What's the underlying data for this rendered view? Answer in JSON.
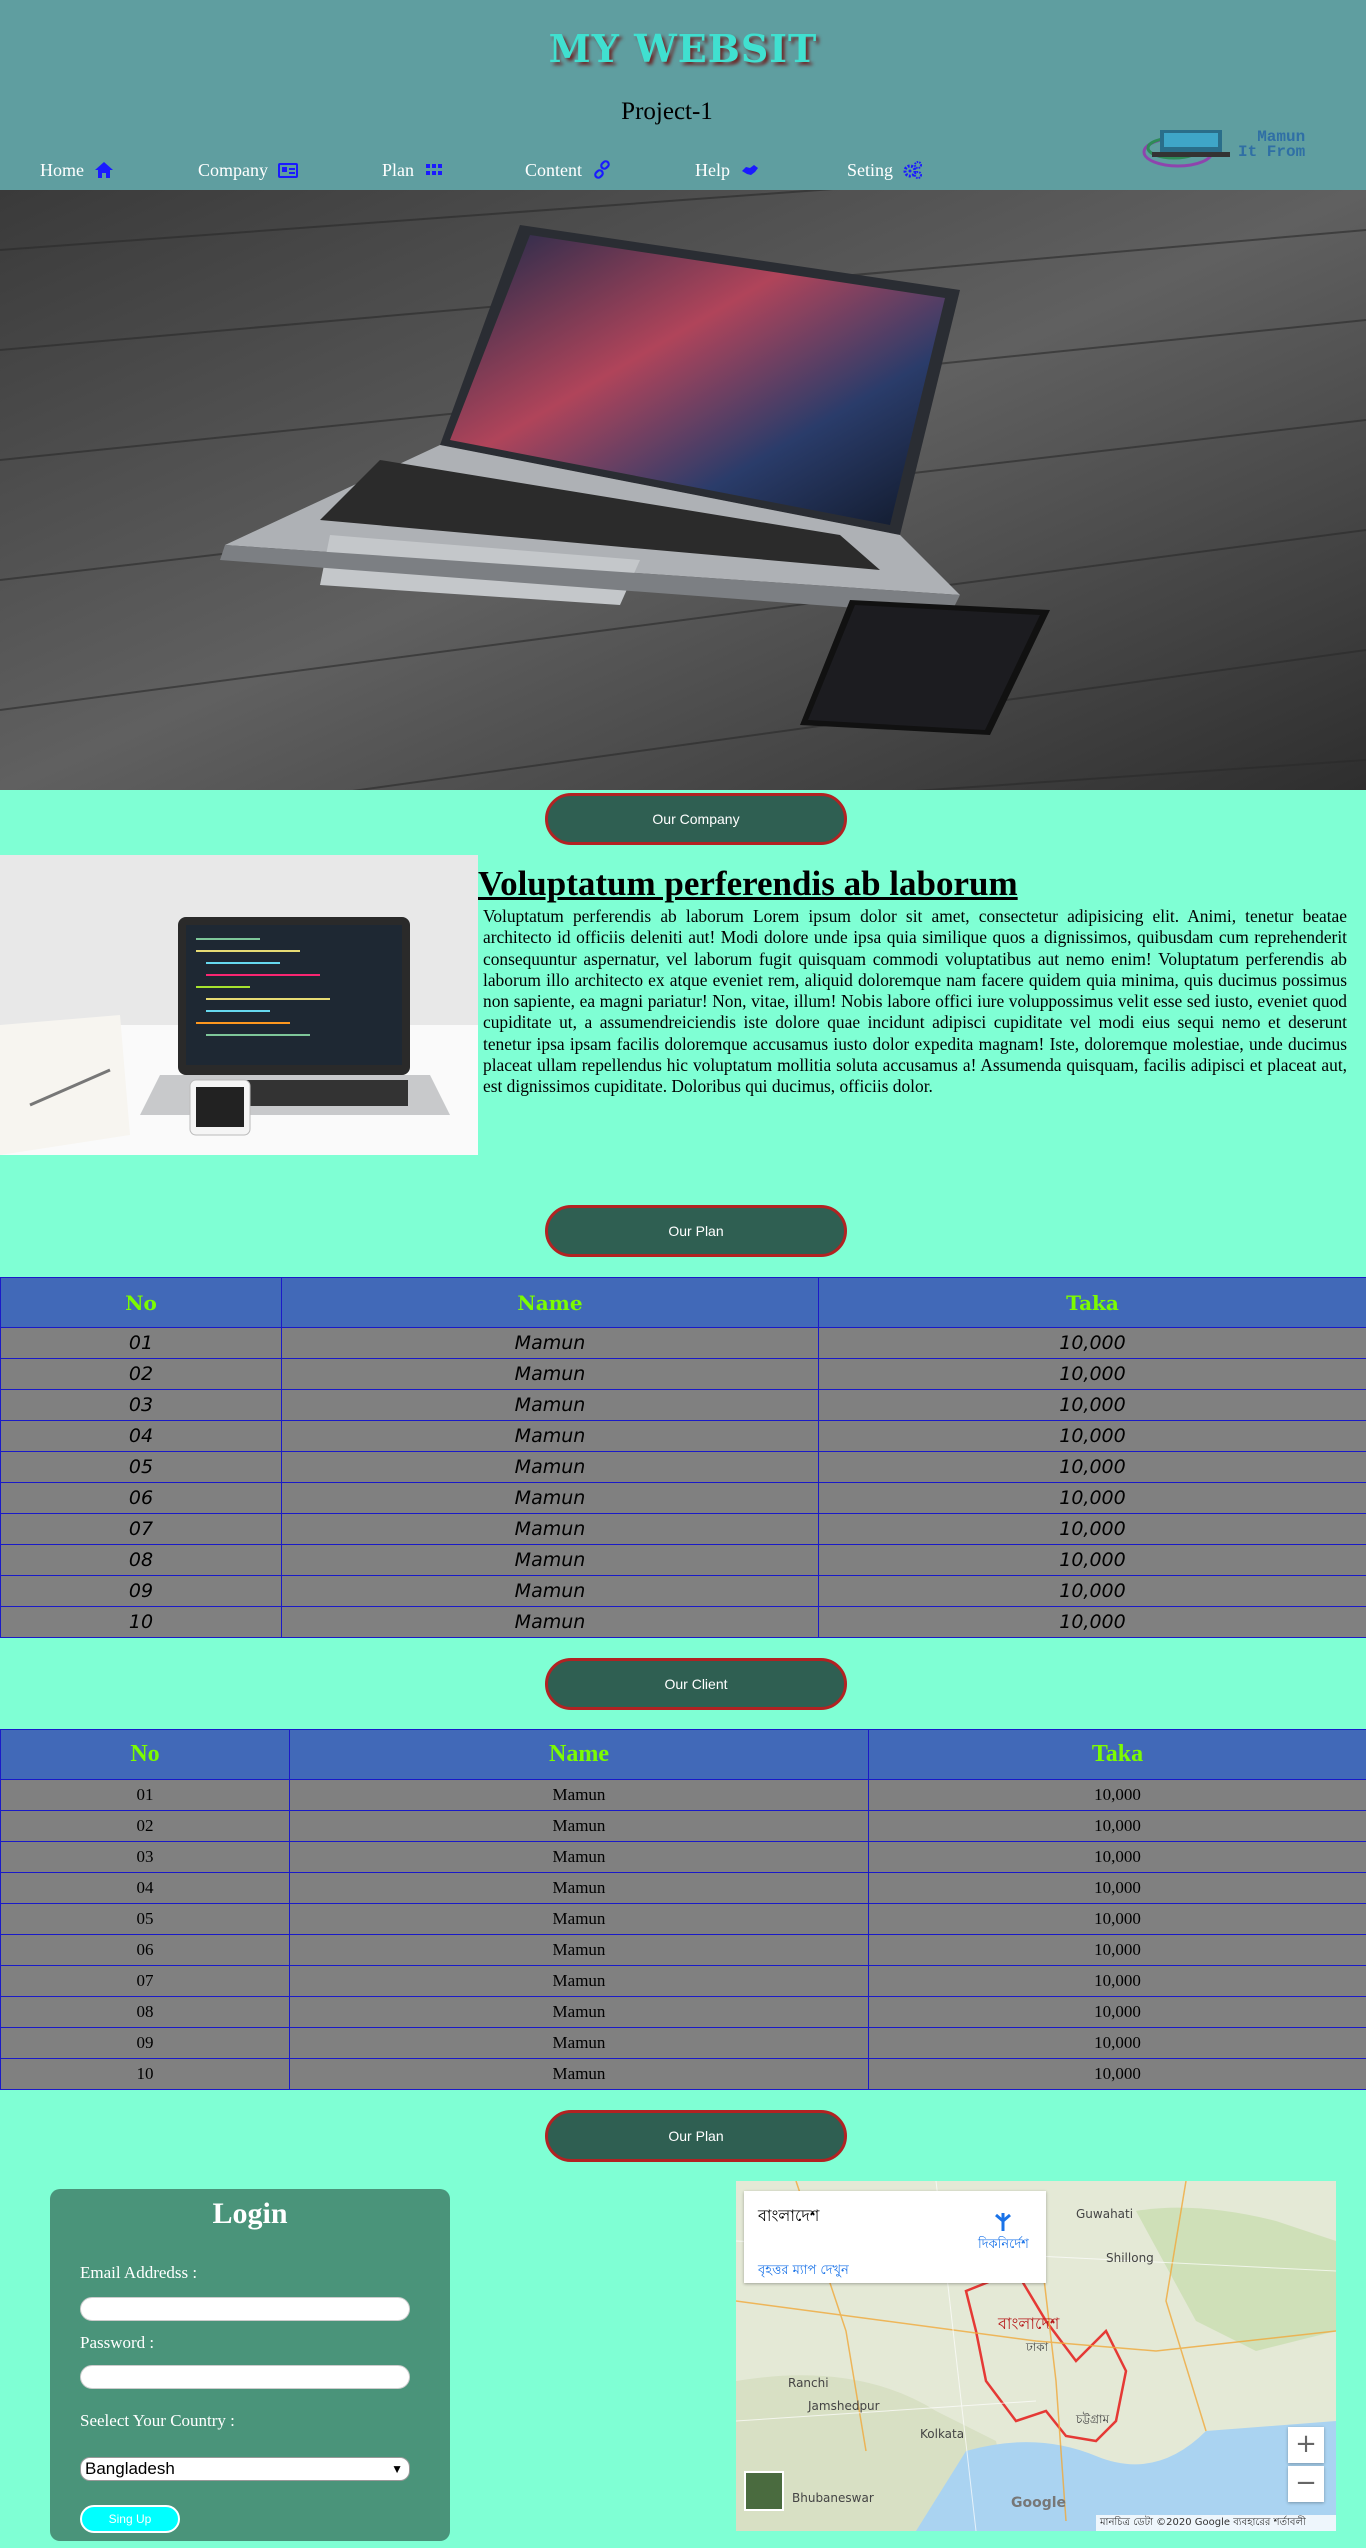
{
  "header": {
    "site_title": "MY WEBSIT",
    "project": "Project-1",
    "nav": [
      {
        "label": "Home",
        "icon": "home-icon"
      },
      {
        "label": "Company",
        "icon": "id-card-icon"
      },
      {
        "label": "Plan",
        "icon": "grid-icon"
      },
      {
        "label": "Content",
        "icon": "link-icon"
      },
      {
        "label": "Help",
        "icon": "handshake-icon"
      },
      {
        "label": "Seting",
        "icon": "gears-icon"
      }
    ],
    "logo_text_1": "Mamun",
    "logo_text_2": "It From"
  },
  "buttons": {
    "company": "Our Company",
    "plan": "Our Plan",
    "client": "Our Client",
    "plan2": "Our Plan"
  },
  "about": {
    "heading": "Voluptatum perferendis ab laborum",
    "text": "Voluptatum perferendis ab laborum Lorem ipsum dolor sit amet, consectetur adipisicing elit. Animi, tenetur beatae architecto id officiis deleniti aut! Modi dolore unde ipsa quia similique quos a dignissimos, quibusdam cum reprehenderit consequuntur aspernatur, vel laborum fugit quisquam commodi voluptatibus aut nemo enim! Voluptatum perferendis ab laborum illo architecto ex atque eveniet rem, aliquid doloremque nam facere quidem quia minima, quis ducimus possimus non sapiente, ea magni pariatur! Non, vitae, illum! Nobis labore offici iure voluppossimus velit esse sed iusto, eveniet quod cupiditate ut, a assumendreiciendis iste dolore quae incidunt adipisci cupiditate vel modi eius sequi nemo et deserunt tenetur ipsa ipsam facilis doloremque accusamus iusto dolor expedita magnam! Iste, doloremque molestiae, unde ducimus placeat ullam repellendus hic voluptatum mollitia soluta accusamus a! Assumenda quisquam, facilis adipisci et placeat aut, est dignissimos cupiditate. Doloribus qui ducimus, officiis dolor."
  },
  "plan_table": {
    "headers": [
      "No",
      "Name",
      "Taka"
    ],
    "rows": [
      [
        "01",
        "Mamun",
        "10,000"
      ],
      [
        "02",
        "Mamun",
        "10,000"
      ],
      [
        "03",
        "Mamun",
        "10,000"
      ],
      [
        "04",
        "Mamun",
        "10,000"
      ],
      [
        "05",
        "Mamun",
        "10,000"
      ],
      [
        "06",
        "Mamun",
        "10,000"
      ],
      [
        "07",
        "Mamun",
        "10,000"
      ],
      [
        "08",
        "Mamun",
        "10,000"
      ],
      [
        "09",
        "Mamun",
        "10,000"
      ],
      [
        "10",
        "Mamun",
        "10,000"
      ]
    ]
  },
  "client_table": {
    "headers": [
      "No",
      "Name",
      "Taka"
    ],
    "rows": [
      [
        "01",
        "Mamun",
        "10,000"
      ],
      [
        "02",
        "Mamun",
        "10,000"
      ],
      [
        "03",
        "Mamun",
        "10,000"
      ],
      [
        "04",
        "Mamun",
        "10,000"
      ],
      [
        "05",
        "Mamun",
        "10,000"
      ],
      [
        "06",
        "Mamun",
        "10,000"
      ],
      [
        "07",
        "Mamun",
        "10,000"
      ],
      [
        "08",
        "Mamun",
        "10,000"
      ],
      [
        "09",
        "Mamun",
        "10,000"
      ],
      [
        "10",
        "Mamun",
        "10,000"
      ]
    ]
  },
  "login": {
    "title": "Login",
    "email_label": "Email Addredss :",
    "password_label": "Password :",
    "country_label": "Seelect Your Country :",
    "country_value": "Bangladesh",
    "signup": "Sing Up"
  },
  "map": {
    "country": "বাংলাদেশ",
    "directions": "দিকনির্দেশ",
    "larger_map": "বৃহত্তর ম্যাপ দেখুন",
    "zoom_in": "+",
    "zoom_out": "−",
    "footer": "মানচিত্র ডেটা ©2020 Google   ব্যবহারের শর্তাবলী",
    "labels": [
      "Guwahati",
      "Shillong",
      "Ranchi",
      "Jamshedpur",
      "Kolkata",
      "Bhubaneswar",
      "বাংলাদেশ",
      "ঢাকা",
      "চট্টগ্রাম",
      "Google"
    ]
  }
}
